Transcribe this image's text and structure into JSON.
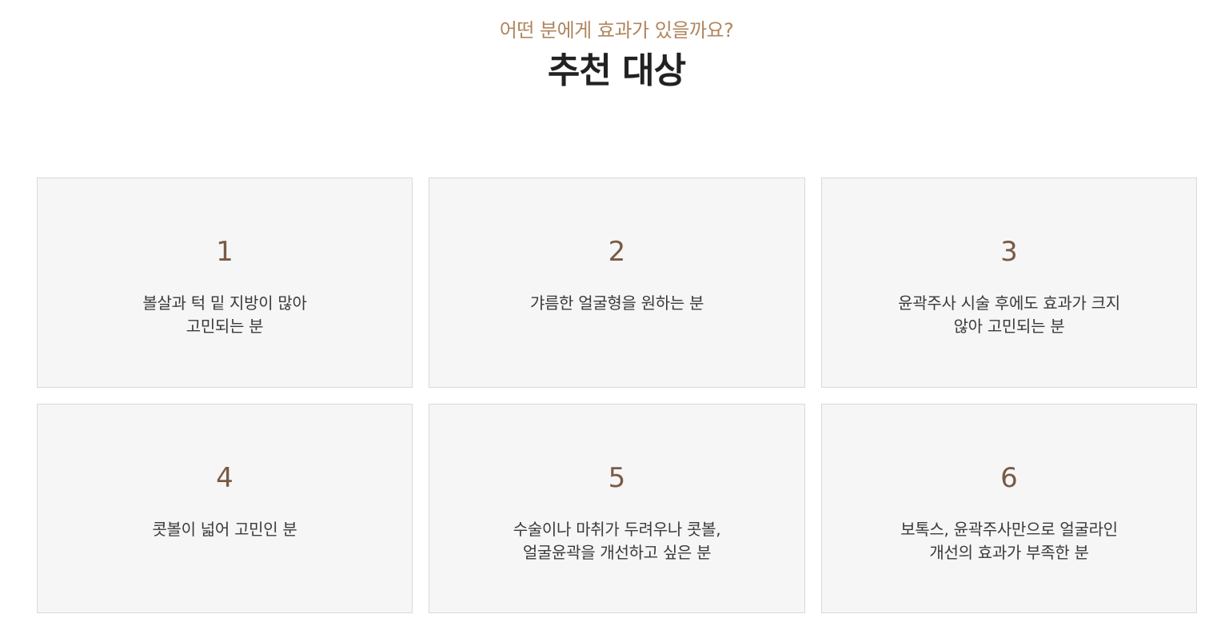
{
  "header": {
    "eyebrow": "어떤 분에게 효과가 있을까요?",
    "title": "추천 대상"
  },
  "cards": [
    {
      "number": "1",
      "text": "볼살과 턱 밑 지방이 많아\n고민되는 분"
    },
    {
      "number": "2",
      "text": "갸름한 얼굴형을 원하는 분"
    },
    {
      "number": "3",
      "text": "윤곽주사 시술 후에도 효과가 크지\n않아 고민되는 분"
    },
    {
      "number": "4",
      "text": "콧볼이 넓어 고민인 분"
    },
    {
      "number": "5",
      "text": "수술이나 마취가 두려우나 콧볼,\n얼굴윤곽을 개선하고 싶은 분"
    },
    {
      "number": "6",
      "text": "보톡스, 윤곽주사만으로 얼굴라인\n개선의 효과가 부족한 분"
    }
  ],
  "colors": {
    "accent": "#b0855e",
    "number": "#7a5a45",
    "card_bg": "#f6f6f6",
    "card_border": "#d9d9d9",
    "title": "#222222"
  }
}
